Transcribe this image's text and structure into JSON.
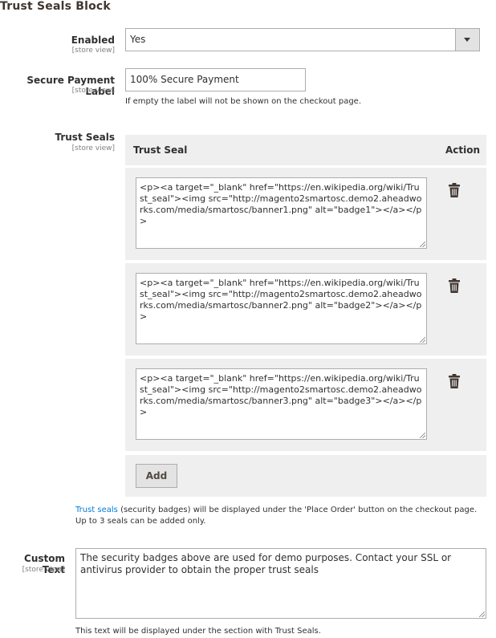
{
  "section": {
    "title": "Trust Seals Block"
  },
  "enabled": {
    "label": "Enabled",
    "scope": "[store view]",
    "value": "Yes"
  },
  "secure_payment": {
    "label": "Secure Payment Label",
    "scope": "[store view]",
    "value": "100% Secure Payment",
    "note": "If empty the label will not be shown on the checkout page."
  },
  "trust_seals": {
    "label": "Trust Seals",
    "scope": "[store view]",
    "columns": {
      "seal": "Trust Seal",
      "action": "Action"
    },
    "rows": [
      {
        "code": "<p><a target=\"_blank\" href=\"https://en.wikipedia.org/wiki/Trust_seal\"><img src=\"http://magento2smartosc.demo2.aheadworks.com/media/smartosc/banner1.png\"  alt=\"badge1\"></a></p>"
      },
      {
        "code": "<p><a target=\"_blank\" href=\"https://en.wikipedia.org/wiki/Trust_seal\"><img src=\"http://magento2smartosc.demo2.aheadworks.com/media/smartosc/banner2.png\"  alt=\"badge2\"></a></p>"
      },
      {
        "code": "<p><a target=\"_blank\" href=\"https://en.wikipedia.org/wiki/Trust_seal\"><img src=\"http://magento2smartosc.demo2.aheadworks.com/media/smartosc/banner3.png\"  alt=\"badge3\"></a></p>"
      }
    ],
    "add_label": "Add",
    "note_link": "Trust seals",
    "note_text": " (security badges) will be displayed under the 'Place Order' button on the checkout page.",
    "note_line2": "Up to 3 seals can be added only.",
    "delete_icon": "trash-icon"
  },
  "custom_text": {
    "label": "Custom Text",
    "scope": "[store view]",
    "value": "The security badges above are used for demo purposes. Contact your SSL or antivirus provider to obtain the proper trust seals",
    "note": "This text will be displayed under the section with Trust Seals."
  }
}
